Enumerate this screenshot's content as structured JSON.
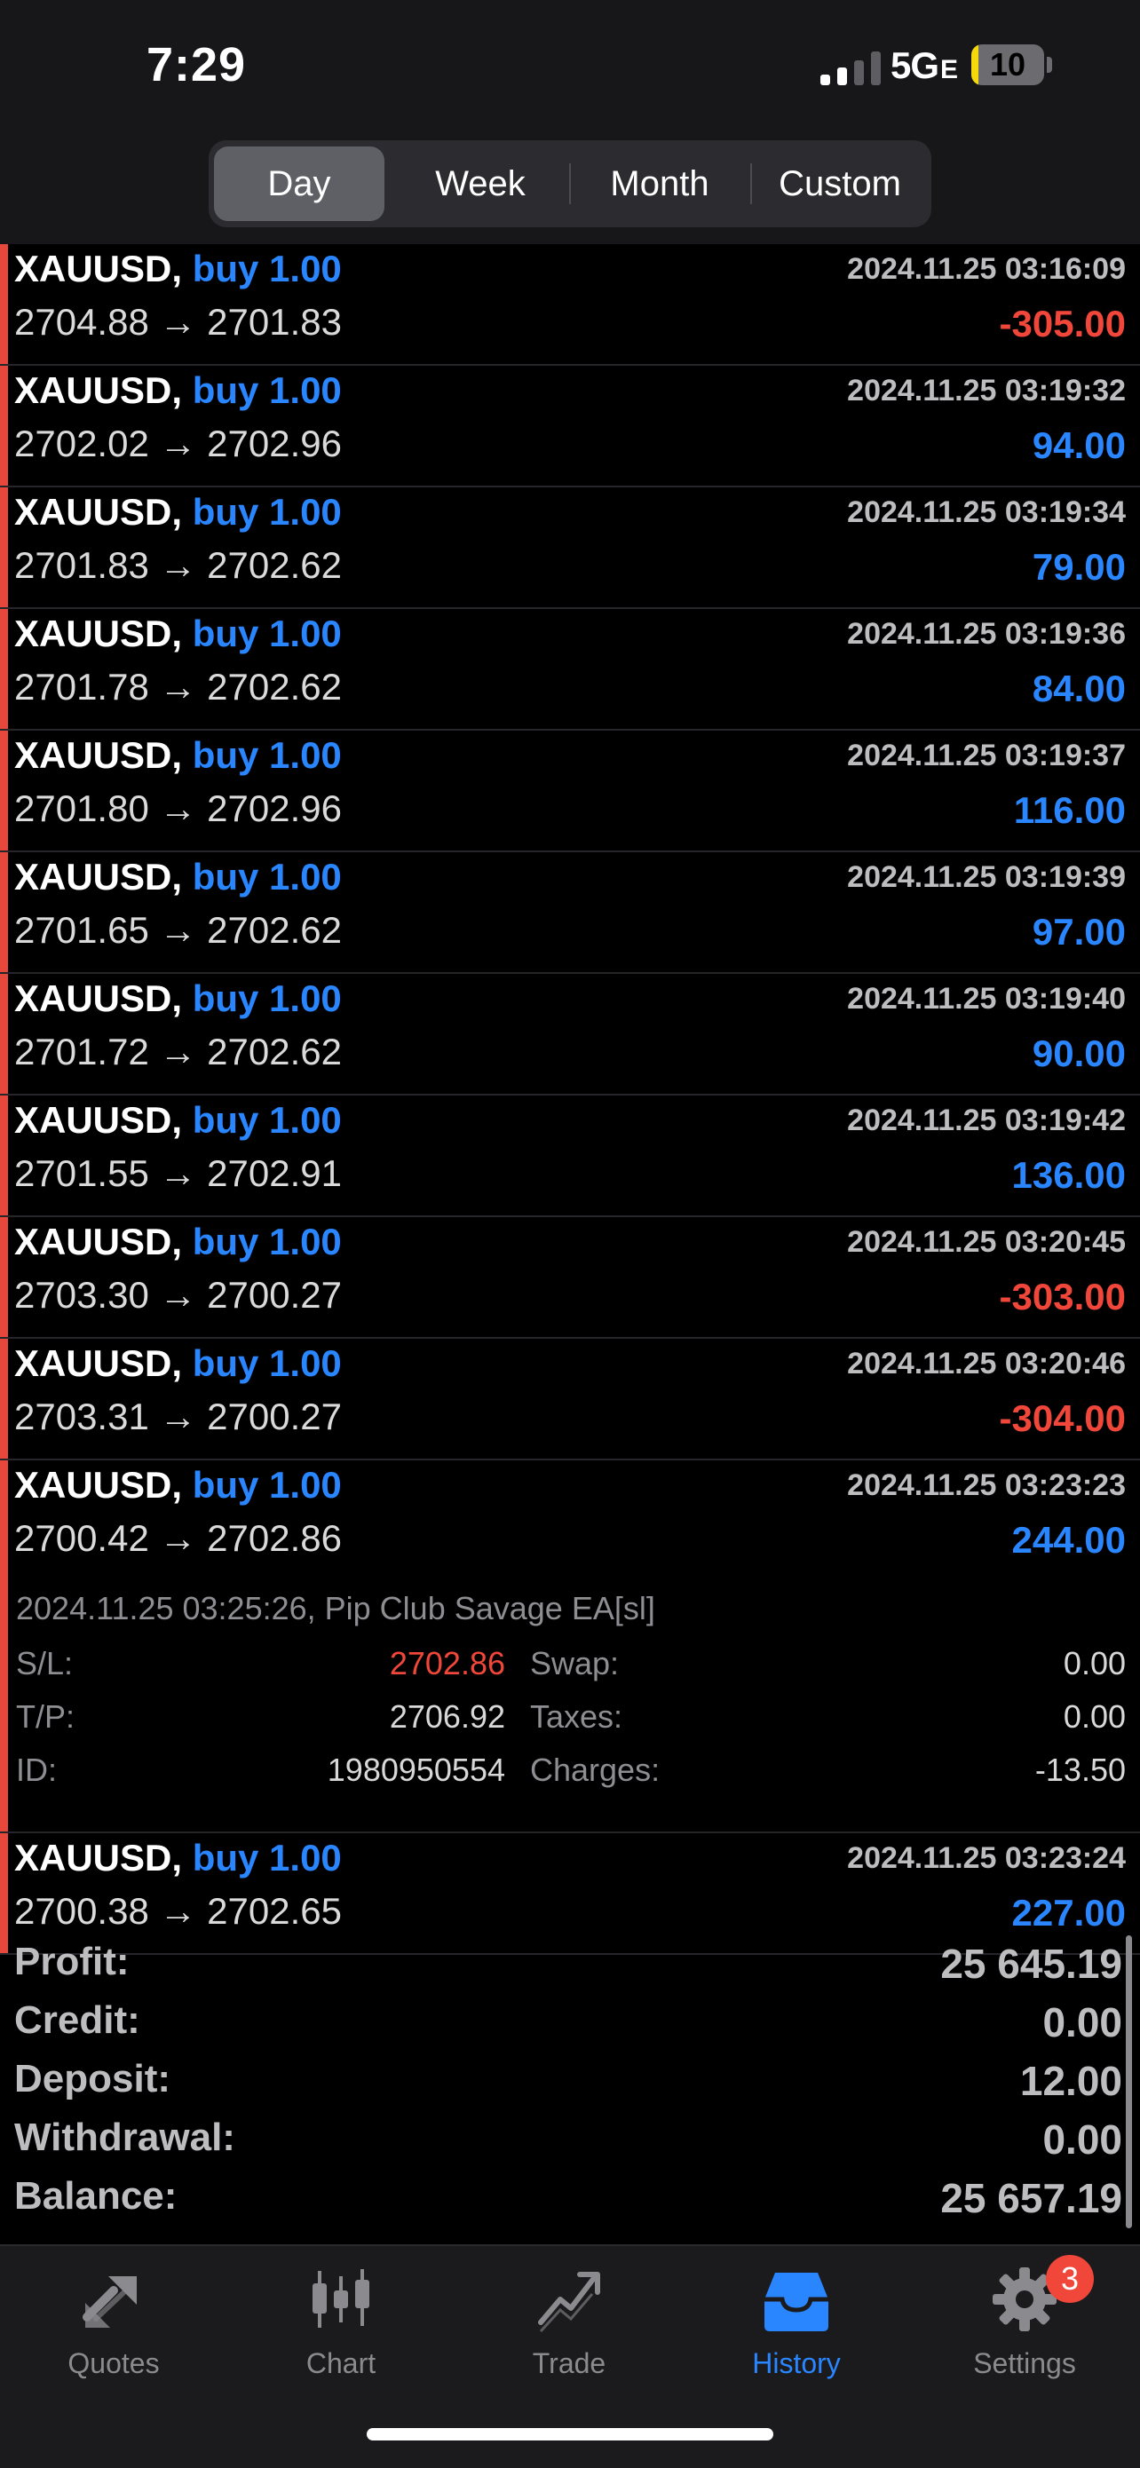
{
  "status_bar": {
    "time": "7:29",
    "network": "5G",
    "network_suffix": "E",
    "battery": "10",
    "battery_level_percent": 10
  },
  "periods": {
    "tabs": [
      "Day",
      "Week",
      "Month",
      "Custom"
    ],
    "active": "Day"
  },
  "deals": [
    {
      "symbol": "XAUUSD,",
      "side": "buy 1.00",
      "prices": "2704.88 → 2701.83",
      "datetime": "2024.11.25 03:16:09",
      "profit": "-305.00",
      "positive": false
    },
    {
      "symbol": "XAUUSD,",
      "side": "buy 1.00",
      "prices": "2702.02 → 2702.96",
      "datetime": "2024.11.25 03:19:32",
      "profit": "94.00",
      "positive": true
    },
    {
      "symbol": "XAUUSD,",
      "side": "buy 1.00",
      "prices": "2701.83 → 2702.62",
      "datetime": "2024.11.25 03:19:34",
      "profit": "79.00",
      "positive": true
    },
    {
      "symbol": "XAUUSD,",
      "side": "buy 1.00",
      "prices": "2701.78 → 2702.62",
      "datetime": "2024.11.25 03:19:36",
      "profit": "84.00",
      "positive": true
    },
    {
      "symbol": "XAUUSD,",
      "side": "buy 1.00",
      "prices": "2701.80 → 2702.96",
      "datetime": "2024.11.25 03:19:37",
      "profit": "116.00",
      "positive": true
    },
    {
      "symbol": "XAUUSD,",
      "side": "buy 1.00",
      "prices": "2701.65 → 2702.62",
      "datetime": "2024.11.25 03:19:39",
      "profit": "97.00",
      "positive": true
    },
    {
      "symbol": "XAUUSD,",
      "side": "buy 1.00",
      "prices": "2701.72 → 2702.62",
      "datetime": "2024.11.25 03:19:40",
      "profit": "90.00",
      "positive": true
    },
    {
      "symbol": "XAUUSD,",
      "side": "buy 1.00",
      "prices": "2701.55 → 2702.91",
      "datetime": "2024.11.25 03:19:42",
      "profit": "136.00",
      "positive": true
    },
    {
      "symbol": "XAUUSD,",
      "side": "buy 1.00",
      "prices": "2703.30 → 2700.27",
      "datetime": "2024.11.25 03:20:45",
      "profit": "-303.00",
      "positive": false
    },
    {
      "symbol": "XAUUSD,",
      "side": "buy 1.00",
      "prices": "2703.31 → 2700.27",
      "datetime": "2024.11.25 03:20:46",
      "profit": "-304.00",
      "positive": false
    },
    {
      "symbol": "XAUUSD,",
      "side": "buy 1.00",
      "prices": "2700.42 → 2702.86",
      "datetime": "2024.11.25 03:23:23",
      "profit": "244.00",
      "positive": true,
      "detail": {
        "close_info": "2024.11.25 03:25:26, Pip Club Savage EA[sl]",
        "sl_label": "S/L:",
        "sl_value": "2702.86",
        "tp_label": "T/P:",
        "tp_value": "2706.92",
        "id_label": "ID:",
        "id_value": "1980950554",
        "swap_label": "Swap:",
        "swap_value": "0.00",
        "taxes_label": "Taxes:",
        "taxes_value": "0.00",
        "charges_label": "Charges:",
        "charges_value": "-13.50"
      }
    },
    {
      "symbol": "XAUUSD,",
      "side": "buy 1.00",
      "prices": "2700.38 → 2702.65",
      "datetime": "2024.11.25 03:23:24",
      "profit": "227.00",
      "positive": true
    }
  ],
  "summary": [
    {
      "label": "Profit:",
      "value": "25 645.19"
    },
    {
      "label": "Credit:",
      "value": "0.00"
    },
    {
      "label": "Deposit:",
      "value": "12.00"
    },
    {
      "label": "Withdrawal:",
      "value": "0.00"
    },
    {
      "label": "Balance:",
      "value": "25 657.19"
    }
  ],
  "tabbar": {
    "tabs": [
      {
        "label": "Quotes",
        "icon": "quotes-arrows-icon"
      },
      {
        "label": "Chart",
        "icon": "candlestick-icon"
      },
      {
        "label": "Trade",
        "icon": "trade-line-icon"
      },
      {
        "label": "History",
        "icon": "inbox-tray-icon",
        "active": true
      },
      {
        "label": "Settings",
        "icon": "gear-icon",
        "badge": "3"
      }
    ]
  },
  "colors": {
    "accent": "#2a86ff",
    "loss": "#f0473a",
    "background": "#000000",
    "header": "#17171a",
    "tabbar": "#1b1b1d"
  }
}
